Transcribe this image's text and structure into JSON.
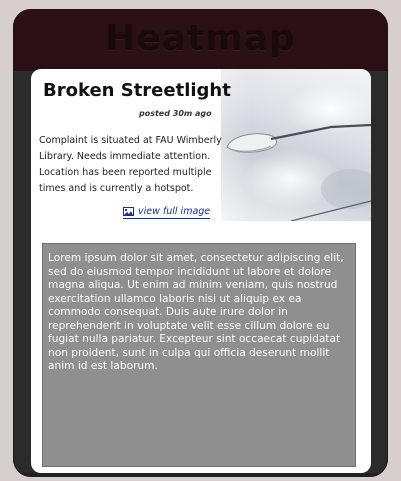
{
  "header": {
    "title": "Heatmap"
  },
  "report": {
    "title": "Broken Streetlight",
    "posted": "posted 30m ago",
    "description": "Complaint is situated at FAU Wimberly Library. Needs immediate attention. Location has been reported multiple times and is currently  a hotspot.",
    "view_image_label": "view full image"
  },
  "details": {
    "body": "Lorem ipsum dolor sit amet, consectetur adipiscing elit, sed do eiusmod tempor incididunt ut labore et dolore magna aliqua. Ut enim ad minim veniam, quis nostrud exercitation ullamco laboris nisi ut aliquip ex ea commodo consequat. Duis aute irure dolor in reprehenderit in voluptate velit esse cillum dolore eu fugiat nulla pariatur. Excepteur sint occaecat cupidatat non proident, sunt in culpa qui officia deserunt mollit anim id est laborum."
  },
  "icons": {
    "view_image": "image-icon",
    "photo": "streetlight-photo"
  },
  "colors": {
    "header_bg": "#2a0f14",
    "link": "#1f2e8a",
    "details_bg": "#8f8f8f"
  }
}
